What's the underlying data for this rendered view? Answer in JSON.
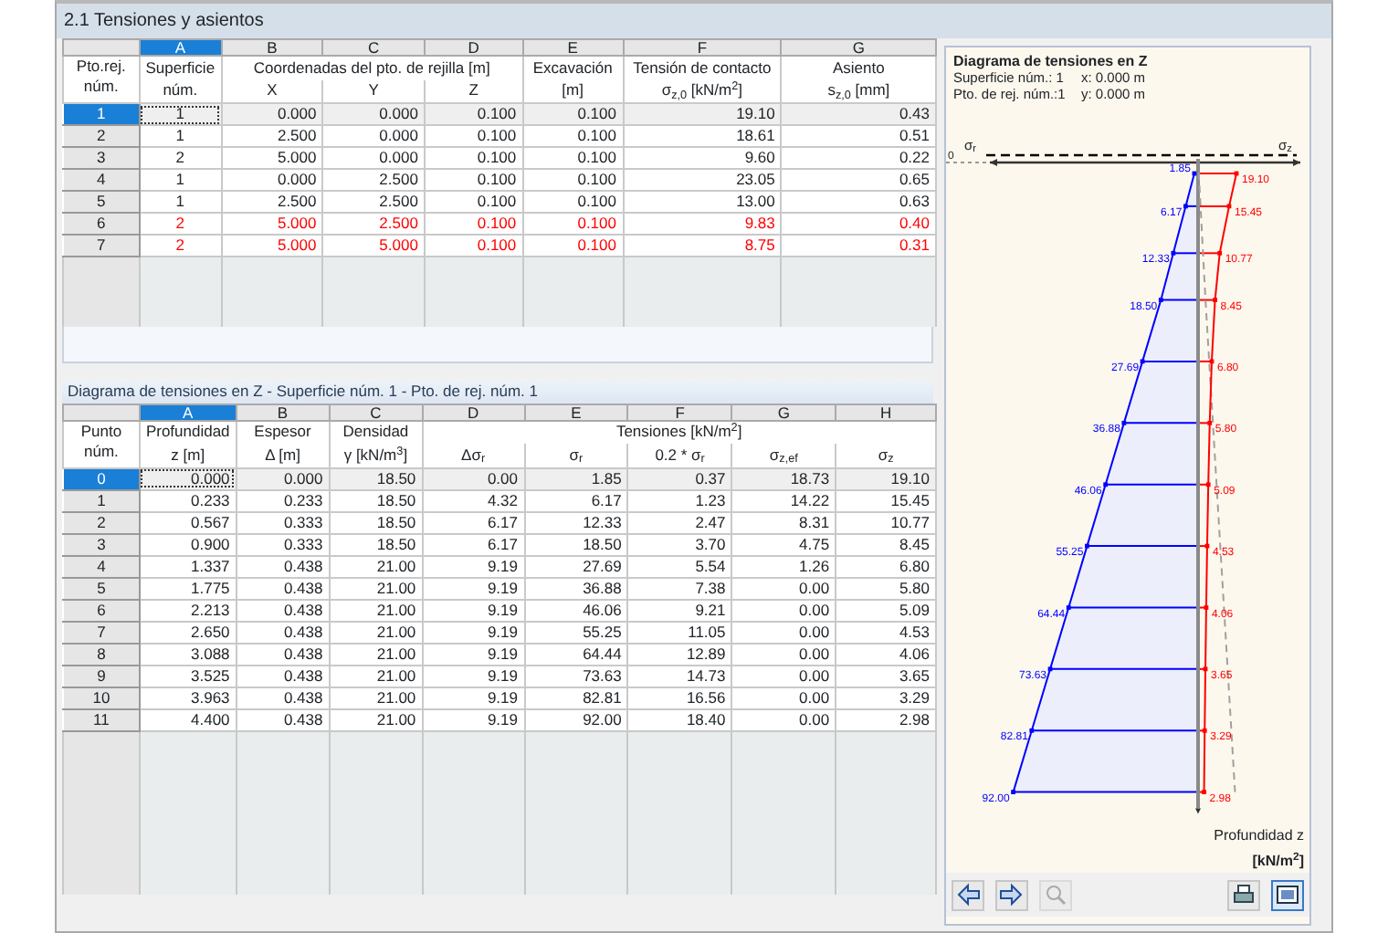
{
  "window": {
    "title": "2.1 Tensiones y asientos"
  },
  "top_table": {
    "corner": [
      "Pto.rej.",
      "núm."
    ],
    "columns": [
      {
        "letter": "A",
        "selected": true,
        "title": "Superficie",
        "sub": "núm."
      },
      {
        "letter": "B",
        "selected": false,
        "group_title": "Coordenadas del pto. de rejilla [m]",
        "sub": "X"
      },
      {
        "letter": "C",
        "selected": false,
        "in_group": true,
        "sub": "Y"
      },
      {
        "letter": "D",
        "selected": false,
        "in_group": true,
        "sub": "Z"
      },
      {
        "letter": "E",
        "selected": false,
        "title": "Excavación",
        "sub": "[m]"
      },
      {
        "letter": "F",
        "selected": false,
        "title": "Tensión de contacto",
        "sub": "σ$_{z,0}$ [kN/m$^{2}$]"
      },
      {
        "letter": "G",
        "selected": false,
        "title": "Asiento",
        "sub": "s$_{z,0}$ [mm]"
      }
    ],
    "rows": [
      {
        "number": "1",
        "selected": true,
        "focused": true,
        "highlighted": false,
        "cells": [
          "1",
          "0.000",
          "0.000",
          "0.100",
          "0.100",
          "19.10",
          "0.43"
        ]
      },
      {
        "number": "2",
        "selected": false,
        "focused": false,
        "highlighted": false,
        "cells": [
          "1",
          "2.500",
          "0.000",
          "0.100",
          "0.100",
          "18.61",
          "0.51"
        ]
      },
      {
        "number": "3",
        "selected": false,
        "focused": false,
        "highlighted": false,
        "cells": [
          "2",
          "5.000",
          "0.000",
          "0.100",
          "0.100",
          "9.60",
          "0.22"
        ]
      },
      {
        "number": "4",
        "selected": false,
        "focused": false,
        "highlighted": false,
        "cells": [
          "1",
          "0.000",
          "2.500",
          "0.100",
          "0.100",
          "23.05",
          "0.65"
        ]
      },
      {
        "number": "5",
        "selected": false,
        "focused": false,
        "highlighted": false,
        "cells": [
          "1",
          "2.500",
          "2.500",
          "0.100",
          "0.100",
          "13.00",
          "0.63"
        ]
      },
      {
        "number": "6",
        "selected": false,
        "focused": false,
        "highlighted": true,
        "cells": [
          "2",
          "5.000",
          "2.500",
          "0.100",
          "0.100",
          "9.83",
          "0.40"
        ]
      },
      {
        "number": "7",
        "selected": false,
        "focused": false,
        "highlighted": true,
        "cells": [
          "2",
          "5.000",
          "5.000",
          "0.100",
          "0.100",
          "8.75",
          "0.31"
        ]
      }
    ]
  },
  "bottom_table": {
    "caption": "Diagrama de tensiones en Z  -  Superficie núm. 1  -  Pto. de rej. núm. 1",
    "corner": [
      "Punto",
      "núm."
    ],
    "columns": [
      {
        "letter": "A",
        "selected": true,
        "title": "Profundidad",
        "sub": "z [m]"
      },
      {
        "letter": "B",
        "selected": false,
        "title": "Espesor",
        "sub": "Δ [m]"
      },
      {
        "letter": "C",
        "selected": false,
        "title": "Densidad",
        "sub": "γ [kN/m$^{3}$]"
      },
      {
        "letter": "D",
        "selected": false,
        "group_title": "Tensiones [kN/m$^{2}$]",
        "sub": "Δσ$_{r}$"
      },
      {
        "letter": "E",
        "selected": false,
        "in_group": true,
        "sub": "σ$_{r}$"
      },
      {
        "letter": "F",
        "selected": false,
        "in_group": true,
        "sub": "0.2 * σ$_{r}$"
      },
      {
        "letter": "G",
        "selected": false,
        "in_group": true,
        "sub": "σ$_{z,ef}$"
      },
      {
        "letter": "H",
        "selected": false,
        "in_group": true,
        "sub": "σ$_{z}$"
      }
    ],
    "rows": [
      {
        "number": "0",
        "selected": true,
        "focused": true,
        "cells": [
          "0.000",
          "0.000",
          "18.50",
          "0.00",
          "1.85",
          "0.37",
          "18.73",
          "19.10"
        ]
      },
      {
        "number": "1",
        "selected": false,
        "focused": false,
        "cells": [
          "0.233",
          "0.233",
          "18.50",
          "4.32",
          "6.17",
          "1.23",
          "14.22",
          "15.45"
        ]
      },
      {
        "number": "2",
        "selected": false,
        "focused": false,
        "cells": [
          "0.567",
          "0.333",
          "18.50",
          "6.17",
          "12.33",
          "2.47",
          "8.31",
          "10.77"
        ]
      },
      {
        "number": "3",
        "selected": false,
        "focused": false,
        "cells": [
          "0.900",
          "0.333",
          "18.50",
          "6.17",
          "18.50",
          "3.70",
          "4.75",
          "8.45"
        ]
      },
      {
        "number": "4",
        "selected": false,
        "focused": false,
        "cells": [
          "1.337",
          "0.438",
          "21.00",
          "9.19",
          "27.69",
          "5.54",
          "1.26",
          "6.80"
        ]
      },
      {
        "number": "5",
        "selected": false,
        "focused": false,
        "cells": [
          "1.775",
          "0.438",
          "21.00",
          "9.19",
          "36.88",
          "7.38",
          "0.00",
          "5.80"
        ]
      },
      {
        "number": "6",
        "selected": false,
        "focused": false,
        "cells": [
          "2.213",
          "0.438",
          "21.00",
          "9.19",
          "46.06",
          "9.21",
          "0.00",
          "5.09"
        ]
      },
      {
        "number": "7",
        "selected": false,
        "focused": false,
        "cells": [
          "2.650",
          "0.438",
          "21.00",
          "9.19",
          "55.25",
          "11.05",
          "0.00",
          "4.53"
        ]
      },
      {
        "number": "8",
        "selected": false,
        "focused": false,
        "cells": [
          "3.088",
          "0.438",
          "21.00",
          "9.19",
          "64.44",
          "12.89",
          "0.00",
          "4.06"
        ]
      },
      {
        "number": "9",
        "selected": false,
        "focused": false,
        "cells": [
          "3.525",
          "0.438",
          "21.00",
          "9.19",
          "73.63",
          "14.73",
          "0.00",
          "3.65"
        ]
      },
      {
        "number": "10",
        "selected": false,
        "focused": false,
        "cells": [
          "3.963",
          "0.438",
          "21.00",
          "9.19",
          "82.81",
          "16.56",
          "0.00",
          "3.29"
        ]
      },
      {
        "number": "11",
        "selected": false,
        "focused": false,
        "cells": [
          "4.400",
          "0.438",
          "21.00",
          "9.19",
          "92.00",
          "18.40",
          "0.00",
          "2.98"
        ]
      }
    ]
  },
  "diagram": {
    "title": "Diagrama de tensiones en Z",
    "info": [
      {
        "label": "Superficie núm.: 1",
        "coord": "x:  0.000 m"
      },
      {
        "label": "Pto. de rej. núm.:1",
        "coord": "y:  0.000 m"
      }
    ],
    "zero_label": "0",
    "left_symbol": "σ$_{r}$",
    "right_symbol": "σ$_{z}$",
    "depth_label": "Profundidad z",
    "unit_label": "[kN/m$^{2}$]",
    "left_labels": [
      "1.85",
      "6.17",
      "12.33",
      "18.50",
      "27.69",
      "36.88",
      "46.06",
      "55.25",
      "64.44",
      "73.63",
      "82.81",
      "92.00"
    ],
    "right_labels": [
      "19.10",
      "15.45",
      "10.77",
      "8.45",
      "6.80",
      "5.80",
      "5.09",
      "4.53",
      "4.06",
      "3.65",
      "3.29",
      "2.98"
    ],
    "toolbar": [
      {
        "kind": "prev",
        "disabled": false,
        "pressed": false
      },
      {
        "kind": "next",
        "disabled": false,
        "pressed": false
      },
      {
        "kind": "zoom",
        "disabled": true,
        "pressed": false
      },
      {
        "kind": "print",
        "disabled": false,
        "pressed": false
      },
      {
        "kind": "view",
        "disabled": false,
        "pressed": true
      }
    ]
  }
}
